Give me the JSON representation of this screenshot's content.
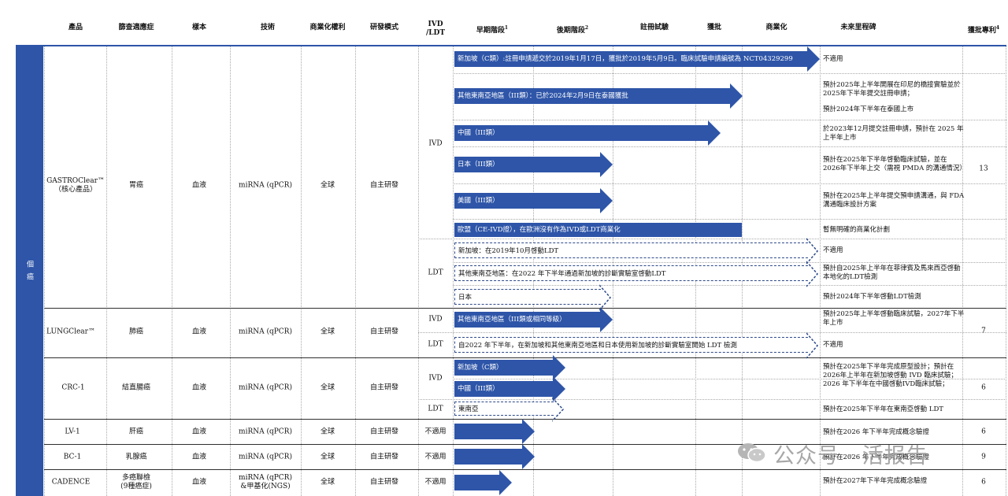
{
  "headers": {
    "product": "產品",
    "indication": "篩查適應症",
    "sample": "樣本",
    "technology": "技術",
    "rights": "商業化權利",
    "rd_model": "研發模式",
    "ivd_ldt_line1": "IVD",
    "ivd_ldt_line2": "/LDT",
    "early": "早期階段",
    "early_sup": "1",
    "late": "後期階段",
    "late_sup": "2",
    "registration": "註冊試驗",
    "approval": "獲批",
    "commercial": "商業化",
    "milestones": "未來里程碑",
    "patents": "獲批專利",
    "patents_sup": "4"
  },
  "sidebar": {
    "label": "個 癌"
  },
  "products": [
    {
      "name": "GASTROClear™",
      "sub": "（核心產品）",
      "indication": "胃癌",
      "sample": "血液",
      "tech": "miRNA (qPCR)",
      "rights": "全球",
      "model": "自主研發",
      "patents": "13",
      "ivd": "IVD",
      "ldt": "LDT"
    },
    {
      "name": "LUNGClear™",
      "indication": "肺癌",
      "sample": "血液",
      "tech": "miRNA (qPCR)",
      "rights": "全球",
      "model": "自主研發",
      "patents": "7",
      "ivd": "IVD",
      "ldt": "LDT"
    },
    {
      "name": "CRC-1",
      "indication": "結直腸癌",
      "sample": "血液",
      "tech": "miRNA (qPCR)",
      "rights": "全球",
      "model": "自主研發",
      "patents": "6",
      "ivd": "IVD",
      "ldt": "LDT"
    },
    {
      "name": "LV-1",
      "indication": "肝癌",
      "sample": "血液",
      "tech": "miRNA (qPCR)",
      "rights": "全球",
      "model": "自主研發",
      "patents": "6",
      "ivd": "不適用"
    },
    {
      "name": "BC-1",
      "indication": "乳腺癌",
      "sample": "血液",
      "tech": "miRNA (qPCR)",
      "rights": "全球",
      "model": "自主研發",
      "patents": "9",
      "ivd": "不適用"
    },
    {
      "name": "CADENCE",
      "indication": "多癌聯檢",
      "indication2": "(9種癌症)",
      "sample": "血液",
      "tech": "miRNA (qPCR)",
      "tech2": "&甲基化(NGS)",
      "rights": "全球",
      "model": "自主研發",
      "patents": "6",
      "ivd": "不適用"
    }
  ],
  "arrows": [
    "新加坡（C類）:註冊申請遞交於2019年1月17日，獲批於2019年5月9日。臨床試驗申請編號為 NCT04329299",
    "其他東南亞地區（III類）：已於2024年2月9日在泰國獲批",
    "中國（III類）",
    "日本（III類）",
    "美國（III類）",
    "歐盟（CE-IVD證），在歐洲沒有作為IVD或LDT商業化",
    "新加坡：在2019年10月啓動LDT",
    "其他東南亞地區：在2022 年下半年通過新加坡的診斷實驗室啓動LDT",
    "日本",
    "其他東南亞地區（III類或相同等級）",
    "自2022 年下半年，在新加坡和其他東南亞地區和日本使用新加坡的診斷實驗室開始 LDT 檢測",
    "新加坡（C類）",
    "中國（III類）",
    "東南亞",
    "",
    "",
    ""
  ],
  "notes": {
    "n1": "不適用",
    "n2a": "預計2025年上半年開展在印尼的橋接實驗並於2025年下半年提交註冊申請；",
    "n2b": "預計2024年下半年在泰國上市",
    "n3": "於2023年12月提交註冊申請，預計在 2025 年上半年上市",
    "n4": "預計在2025年下半年啓動臨床試驗，並在 2026年下半年上交（需視 PMDA 的溝通情況）",
    "n5": "預計在2025年上半年提交預申請溝通，與 FDA溝通臨床設計方案",
    "n6": "暫無明確的商業化計劃",
    "n7": "不適用",
    "n8": "預計自2025年上半年在菲律賓及馬來西亞啓動本地化的LDT檢測",
    "n9": "預計2024年下半年啓動LDT檢測",
    "n10": "預計2025年上半年啓動臨床試驗，2027年下半年上市",
    "n11": "不適用",
    "n12": "預計在2025年下半年完成原型設計；預計在2026年上半年在新加坡啓動 IVD 臨床試驗； 2026 年下半年在中國啓動IVD臨床試驗；",
    "n13": "預計在2025年下半年在東南亞啓動 LDT",
    "n14": "預計在2026 年下半年完成概念驗證",
    "n15": "預計在2026 年下半年完成概念驗證",
    "n16": "預計在2027年下半年完成概念驗證"
  },
  "watermark": "公众号 · 活报告",
  "colors": {
    "arrow_blue": "#2e55a8",
    "dashed": "#2e4a8a"
  }
}
